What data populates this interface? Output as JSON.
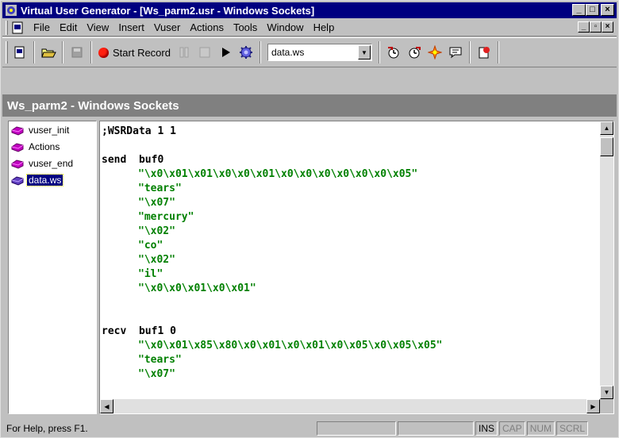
{
  "window": {
    "title": "Virtual User Generator - [Ws_parm2.usr - Windows Sockets]",
    "min": "_",
    "max": "□",
    "close": "×"
  },
  "menu": {
    "items": [
      {
        "label": "File",
        "key": "F"
      },
      {
        "label": "Edit",
        "key": "E"
      },
      {
        "label": "View",
        "key": "V"
      },
      {
        "label": "Insert",
        "key": "I"
      },
      {
        "label": "Vuser",
        "key": "u"
      },
      {
        "label": "Actions",
        "key": "A"
      },
      {
        "label": "Tools",
        "key": "T"
      },
      {
        "label": "Window",
        "key": "W"
      },
      {
        "label": "Help",
        "key": "H"
      }
    ]
  },
  "toolbar": {
    "record_label": "Start Record",
    "combo_value": "data.ws"
  },
  "document": {
    "header": "Ws_parm2 - Windows Sockets"
  },
  "tree": {
    "items": [
      {
        "label": "vuser_init"
      },
      {
        "label": "Actions"
      },
      {
        "label": "vuser_end"
      },
      {
        "label": "data.ws",
        "selected": true
      }
    ]
  },
  "code": {
    "lines": [
      {
        "text": ";WSRData 1 1",
        "type": "plain"
      },
      {
        "text": "",
        "type": "blank"
      },
      {
        "text": "send  buf0",
        "type": "plain"
      },
      {
        "text": "\"\\x0\\x01\\x01\\x0\\x0\\x01\\x0\\x0\\x0\\x0\\x0\\x0\\x05\"",
        "type": "str"
      },
      {
        "text": "\"tears\"",
        "type": "str"
      },
      {
        "text": "\"\\x07\"",
        "type": "str"
      },
      {
        "text": "\"mercury\"",
        "type": "str"
      },
      {
        "text": "\"\\x02\"",
        "type": "str"
      },
      {
        "text": "\"co\"",
        "type": "str"
      },
      {
        "text": "\"\\x02\"",
        "type": "str"
      },
      {
        "text": "\"il\"",
        "type": "str"
      },
      {
        "text": "\"\\x0\\x0\\x01\\x0\\x01\"",
        "type": "str"
      },
      {
        "text": "",
        "type": "blank"
      },
      {
        "text": "",
        "type": "blank"
      },
      {
        "text": "recv  buf1 0",
        "type": "plain"
      },
      {
        "text": "\"\\x0\\x01\\x85\\x80\\x0\\x01\\x0\\x01\\x0\\x05\\x0\\x05\\x05\"",
        "type": "str"
      },
      {
        "text": "\"tears\"",
        "type": "str"
      },
      {
        "text": "\"\\x07\"",
        "type": "str"
      }
    ]
  },
  "status": {
    "help": "For Help, press F1.",
    "ins": "INS",
    "cap": "CAP",
    "num": "NUM",
    "scrl": "SCRL"
  },
  "colors": {
    "title_bg": "#000080",
    "string": "#008000",
    "header_bg": "#808080"
  }
}
